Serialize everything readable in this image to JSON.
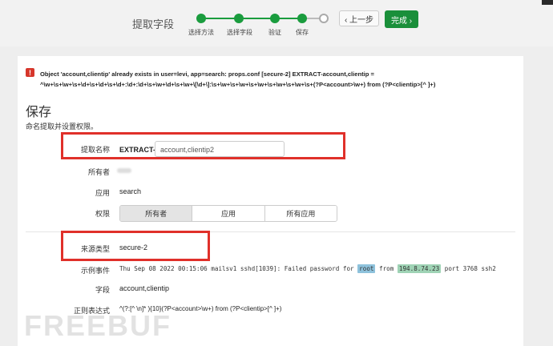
{
  "wizard": {
    "title": "提取字段",
    "steps": [
      "选择方法",
      "选择字段",
      "验证",
      "保存"
    ],
    "prev_label": "‹ 上一步",
    "done_label": "完成 ›"
  },
  "error": {
    "icon": "exclamation-icon",
    "message": "Object 'account,clientip' already exists in user=levi, app=search: props.conf [secure-2] EXTRACT-account,clientip = ^\\w+\\s+\\w+\\s+\\d+\\s+\\d+\\s+\\d+:\\d+:\\d+\\s+\\w+\\d+\\s+\\w+\\[\\d+\\]:\\s+\\w+\\s+\\w+\\s+\\w+\\s+\\w+\\s+\\w+\\s+(?P<account>\\w+) from (?P<clientip>[^ ]+)"
  },
  "section": {
    "title": "保存",
    "subtitle": "命名提取并设置权限。"
  },
  "form": {
    "name_label": "提取名称",
    "name_prefix": "EXTRACT-",
    "name_value": "account,clientip2",
    "owner_label": "所有者",
    "app_label": "应用",
    "app_value": "search",
    "perm_label": "权限",
    "perm_options": [
      "所有者",
      "应用",
      "所有应用"
    ],
    "perm_selected": "所有者",
    "sourcetype_label": "来源类型",
    "sourcetype_value": "secure-2",
    "sample_label": "示例事件",
    "sample_before": "Thu Sep 08 2022 00:15:06 mailsv1 sshd[1039]: Failed password for ",
    "sample_user": "root",
    "sample_middle": " from ",
    "sample_ip": "194.8.74.23",
    "sample_after": " port 3768 ssh2",
    "fields_label": "字段",
    "fields_value": "account,clientip",
    "regex_label": "正则表达式",
    "regex_value": "^(?:[^ \\n]* ){10}(?P<account>\\w+) from (?P<clientip>[^ ]+)"
  },
  "colors": {
    "accent_green": "#1a8f3a",
    "error_red": "#d6362b",
    "annotation_red": "#e0302a",
    "highlight_user": "#8ec2dc",
    "highlight_ip": "#9fd3b5"
  },
  "watermark": "FREEBUF"
}
